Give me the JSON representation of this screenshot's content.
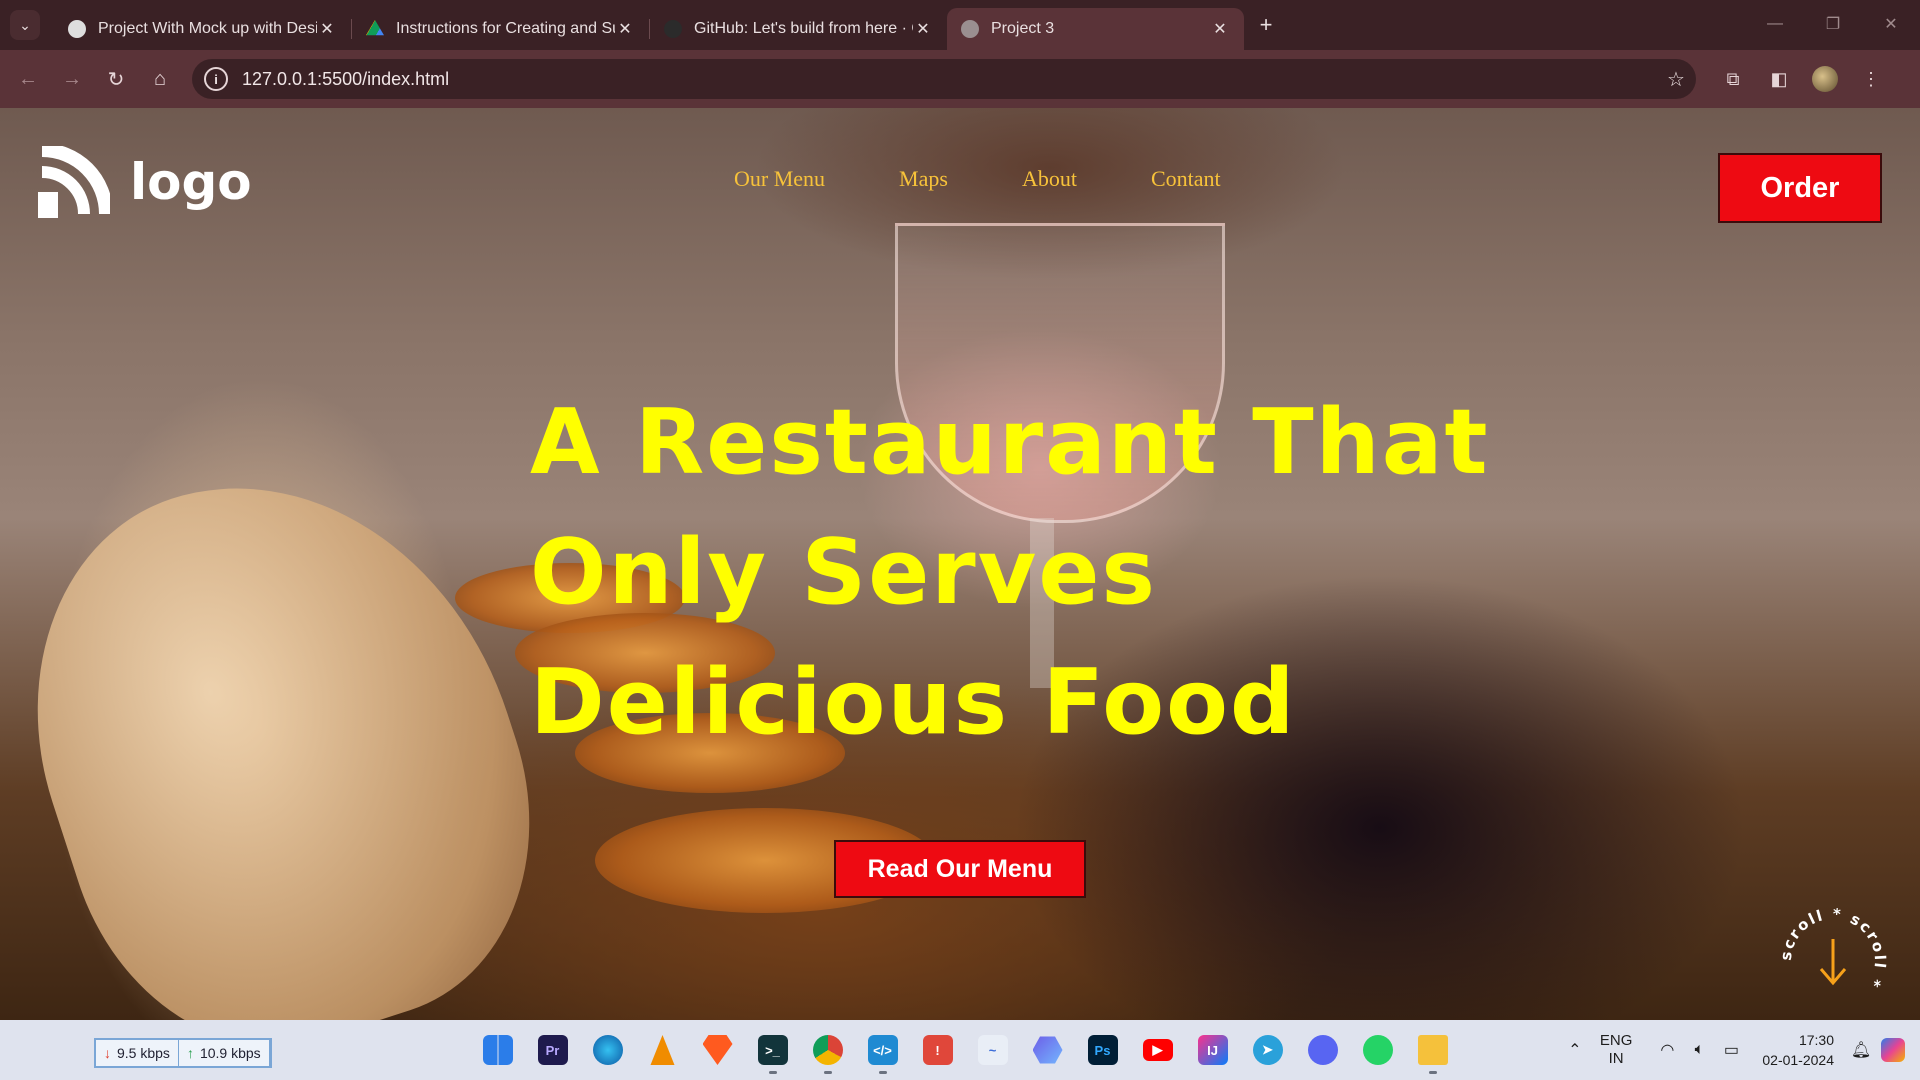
{
  "browser": {
    "tabs": [
      {
        "title": "Project With Mock up with Desi",
        "favicon_color": "#dedede",
        "active": false
      },
      {
        "title": "Instructions for Creating and Su",
        "favicon_color": "#f4b400",
        "active": false
      },
      {
        "title": "GitHub: Let's build from here · G",
        "favicon_color": "#2b2b2b",
        "active": false
      },
      {
        "title": "Project 3",
        "favicon_color": "#9a8f90",
        "active": true
      }
    ],
    "url": "127.0.0.1:5500/index.html"
  },
  "site": {
    "logo_text": "logo",
    "nav": [
      "Our Menu",
      "Maps",
      "About",
      "Contant"
    ],
    "order_label": "Order",
    "hero_lines": [
      "A Restaurant That",
      "Only Serves",
      "Delicious Food"
    ],
    "menu_button": "Read Our Menu",
    "scroll_badge_text": "scroll * scroll *",
    "colors": {
      "accent_red": "#ee0a12",
      "nav_gold": "#f7c23a",
      "hero_yellow": "#ffff00"
    }
  },
  "taskbar": {
    "download_speed": "9.5 kbps",
    "upload_speed": "10.9 kbps",
    "apps": [
      "windows-start",
      "premiere-pro",
      "edge",
      "vlc",
      "brave",
      "terminal",
      "chrome",
      "vscode",
      "app-red",
      "app-chart",
      "app-hex",
      "photoshop",
      "youtube",
      "intellij",
      "telegram",
      "discord",
      "whatsapp",
      "file-explorer"
    ],
    "lang_top": "ENG",
    "lang_bottom": "IN",
    "time": "17:30",
    "date": "02-01-2024"
  }
}
